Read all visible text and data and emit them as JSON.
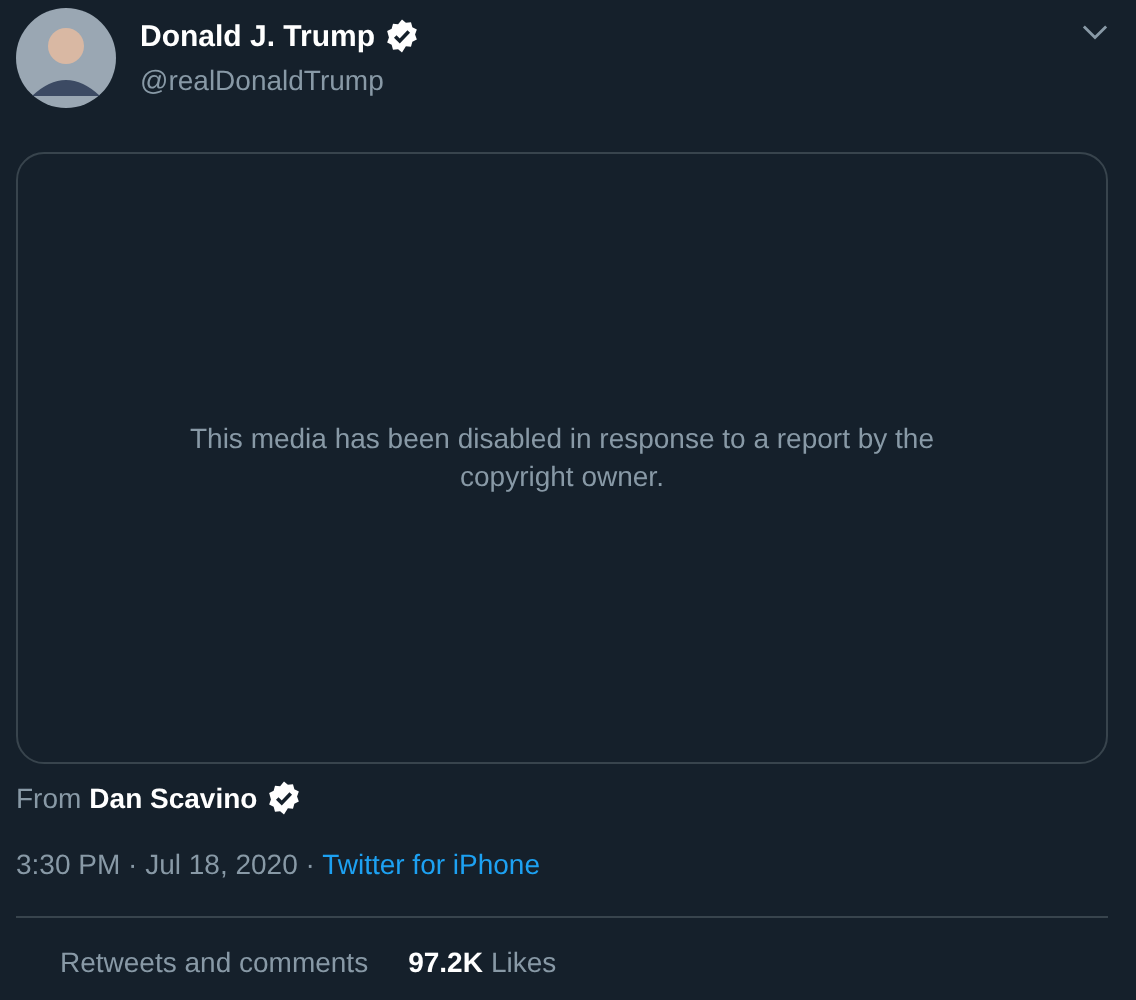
{
  "author": {
    "name": "Donald J. Trump",
    "handle": "@realDonaldTrump",
    "verified": true
  },
  "media": {
    "message": "This media has been disabled in response to a report by the copyright owner."
  },
  "source": {
    "prefix": "From",
    "name": "Dan Scavino",
    "verified": true
  },
  "meta": {
    "time": "3:30 PM · Jul 18, 2020 · ",
    "client": "Twitter for iPhone"
  },
  "stats": [
    {
      "label": "Retweets and comments"
    },
    {
      "count": "97.2K",
      "label": "Likes"
    }
  ]
}
